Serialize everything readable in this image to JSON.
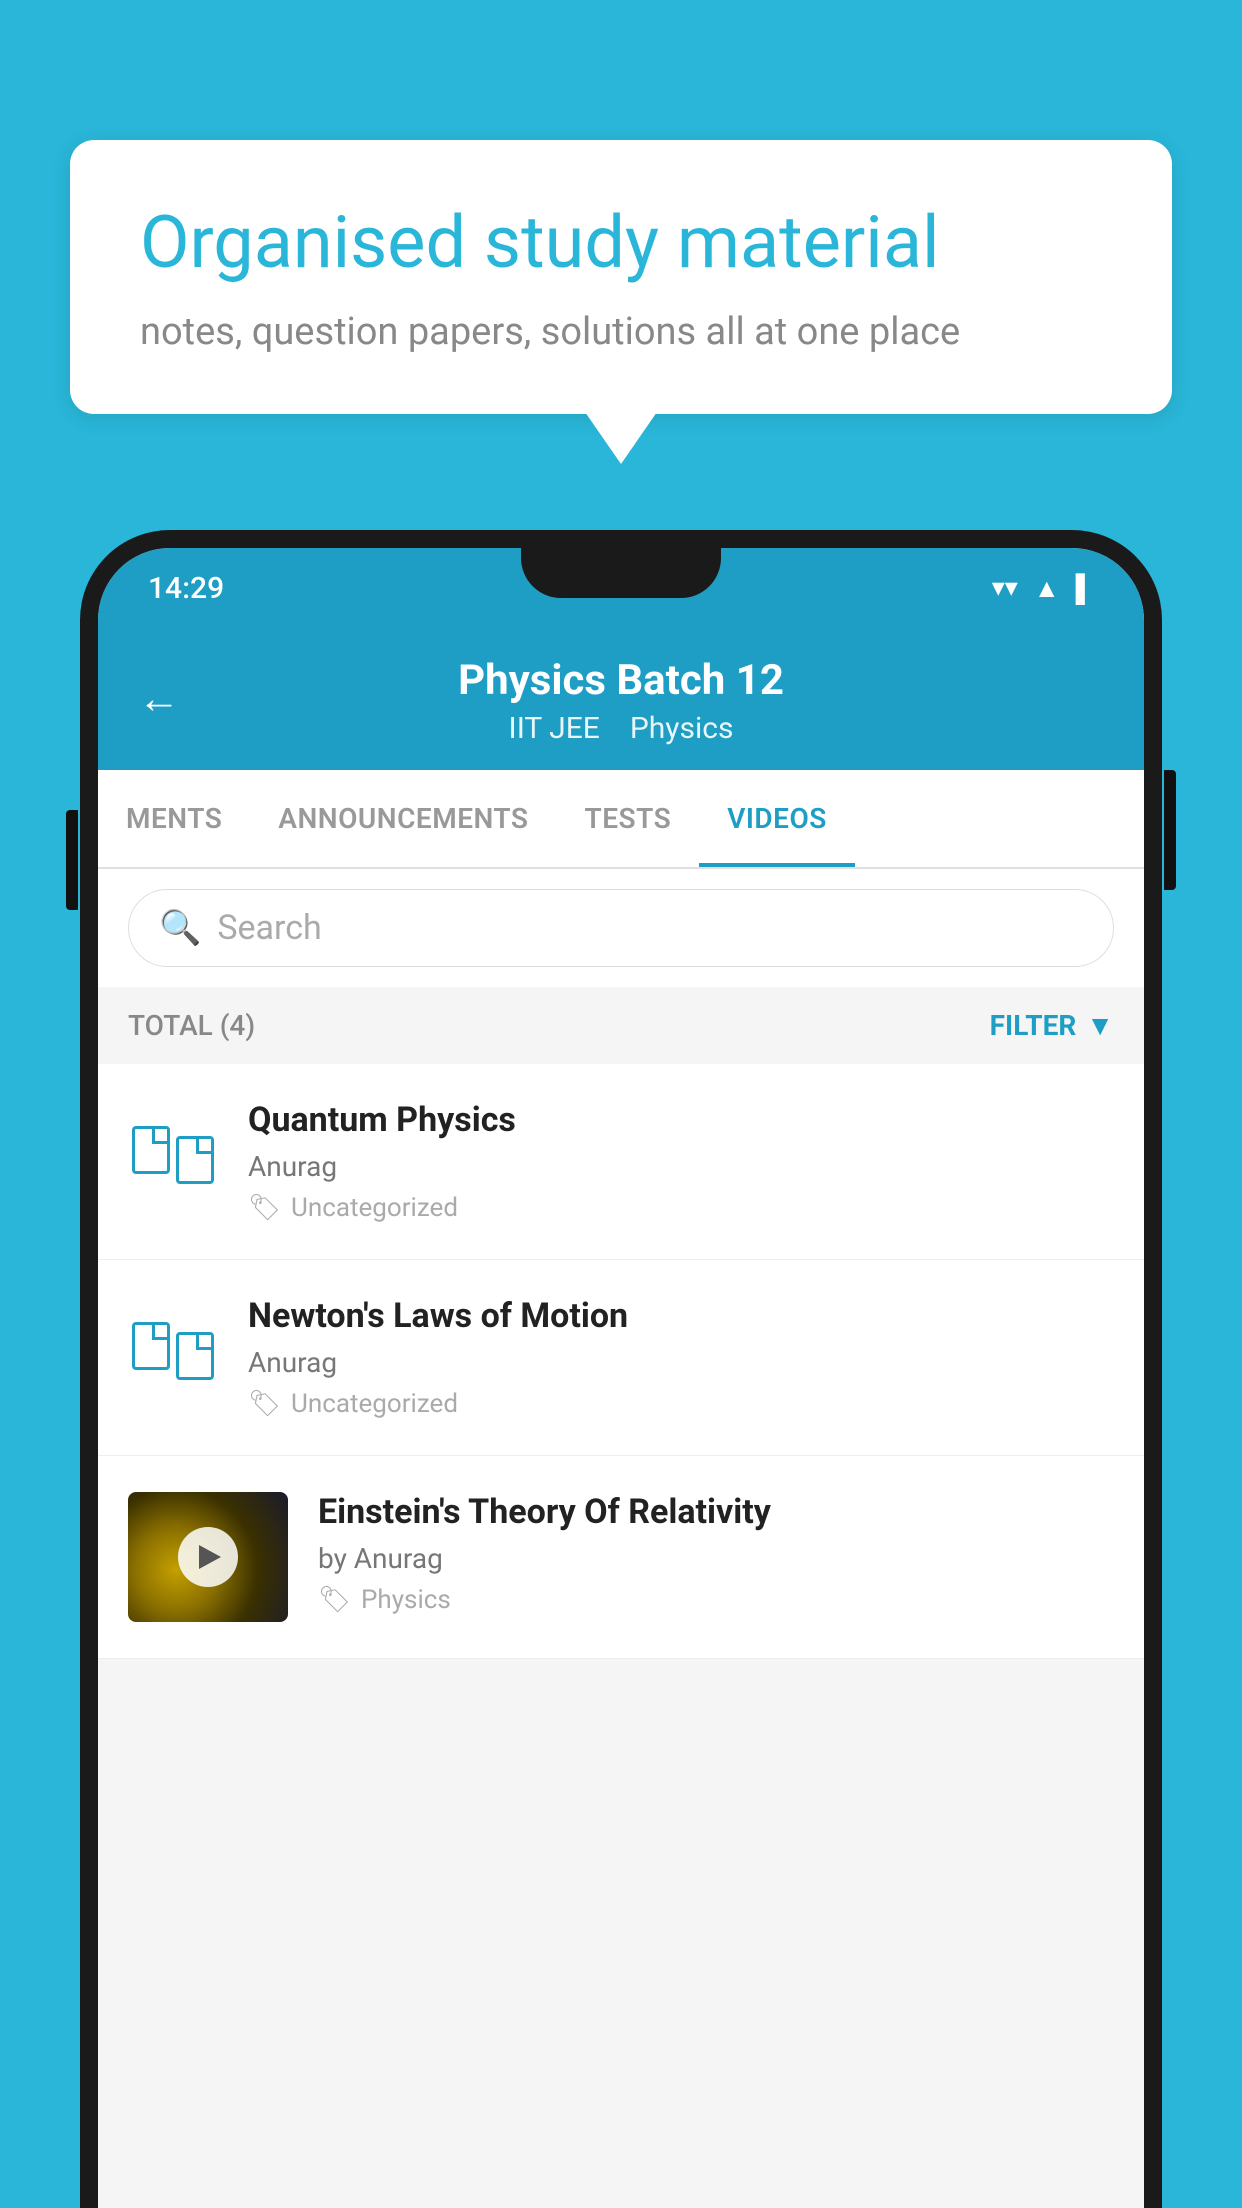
{
  "background_color": "#29b6d8",
  "speech_bubble": {
    "title": "Organised study material",
    "subtitle": "notes, question papers, solutions all at one place"
  },
  "phone": {
    "status_bar": {
      "time": "14:29",
      "signal_icon": "▲",
      "wifi_icon": "▼",
      "battery_icon": "▌"
    },
    "app_bar": {
      "back_label": "←",
      "title": "Physics Batch 12",
      "tags": [
        "IIT JEE",
        "Physics"
      ]
    },
    "tabs": [
      {
        "label": "MENTS",
        "active": false
      },
      {
        "label": "ANNOUNCEMENTS",
        "active": false
      },
      {
        "label": "TESTS",
        "active": false
      },
      {
        "label": "VIDEOS",
        "active": true
      }
    ],
    "search": {
      "placeholder": "Search"
    },
    "filter_bar": {
      "total_label": "TOTAL (4)",
      "filter_label": "FILTER"
    },
    "video_items": [
      {
        "id": 1,
        "title": "Quantum Physics",
        "author": "Anurag",
        "tag": "Uncategorized",
        "has_thumbnail": false
      },
      {
        "id": 2,
        "title": "Newton's Laws of Motion",
        "author": "Anurag",
        "tag": "Uncategorized",
        "has_thumbnail": false
      },
      {
        "id": 3,
        "title": "Einstein's Theory Of Relativity",
        "author": "by Anurag",
        "tag": "Physics",
        "has_thumbnail": true
      }
    ]
  }
}
